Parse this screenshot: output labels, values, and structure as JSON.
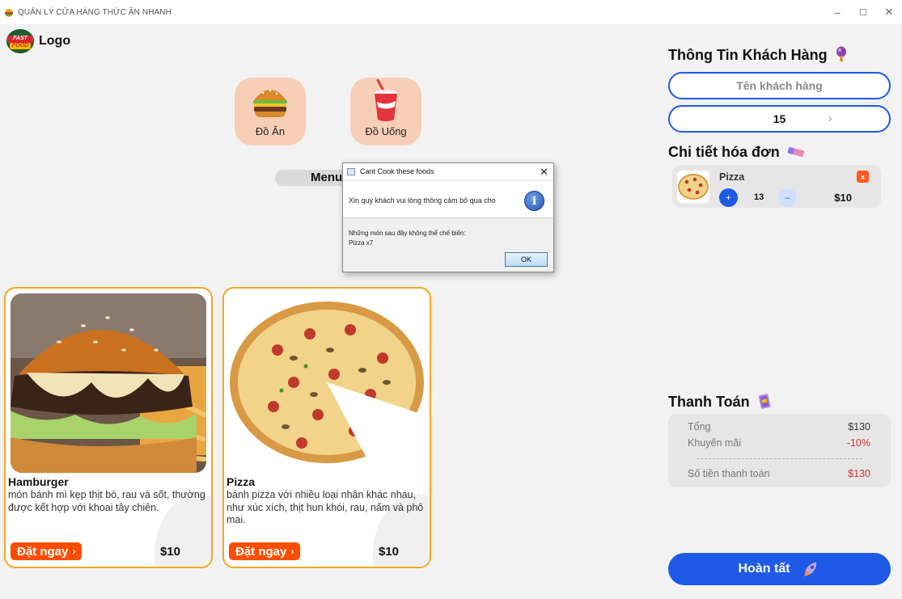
{
  "window": {
    "title": "QUẢN LÝ CỬA HÀNG THỨC ĂN NHANH",
    "minimize_glyph": "–",
    "maximize_glyph": "☐",
    "close_glyph": "✕"
  },
  "logo": {
    "badge_text_line1": "FAST",
    "badge_text_line2": "FOOD",
    "label": "Logo"
  },
  "categories": [
    {
      "label": "Đồ Ăn",
      "icon": "burger-icon"
    },
    {
      "label": "Đồ Uống",
      "icon": "drink-icon"
    }
  ],
  "menu_tab": {
    "label": "Menu"
  },
  "foods": [
    {
      "name": "Hamburger",
      "description": "món bánh mì kẹp thịt bò, rau và sốt, thường được kết hợp với khoai tây chiên.",
      "order_label": "Đặt ngay",
      "price": "$10"
    },
    {
      "name": "Pizza",
      "description": "bánh pizza với nhiều loại nhân khác nhau, như xúc xích, thịt hun khói, rau, nấm và phô mai.",
      "order_label": "Đặt ngay",
      "price": "$10"
    }
  ],
  "customer": {
    "heading": "Thông Tin Khách Hàng",
    "name_placeholder": "Tên khách hàng",
    "table_number": "15",
    "chevron": "›"
  },
  "bill": {
    "heading": "Chi tiết hóa đơn",
    "items": [
      {
        "name": "Pizza",
        "quantity": "13",
        "price": "$10",
        "remove_label": "x",
        "plus_label": "+",
        "minus_label": "–"
      }
    ]
  },
  "payment": {
    "heading": "Thanh Toán",
    "total_label": "Tổng",
    "total_value": "$130",
    "discount_label": "Khuyến mãi",
    "discount_value": "-10%",
    "due_label": "Số tiền thanh toán",
    "due_value": "$130"
  },
  "done_button": {
    "label": "Hoàn tất"
  },
  "dialog": {
    "title": "Cant Cook these foods",
    "close_glyph": "✕",
    "message": "Xin quý khách vui lòng thông cảm bỏ qua cho",
    "detail_line1": "Những món sau đây không thể chế biến:",
    "detail_line2": "Pizza x7",
    "ok_label": "OK",
    "info_glyph": "i"
  },
  "colors": {
    "accent_blue": "#1e5ae6",
    "order_orange": "#ff4d00",
    "card_border": "#f5a623",
    "category_bg": "#f6cfb6",
    "discount_red": "#d0312d"
  }
}
